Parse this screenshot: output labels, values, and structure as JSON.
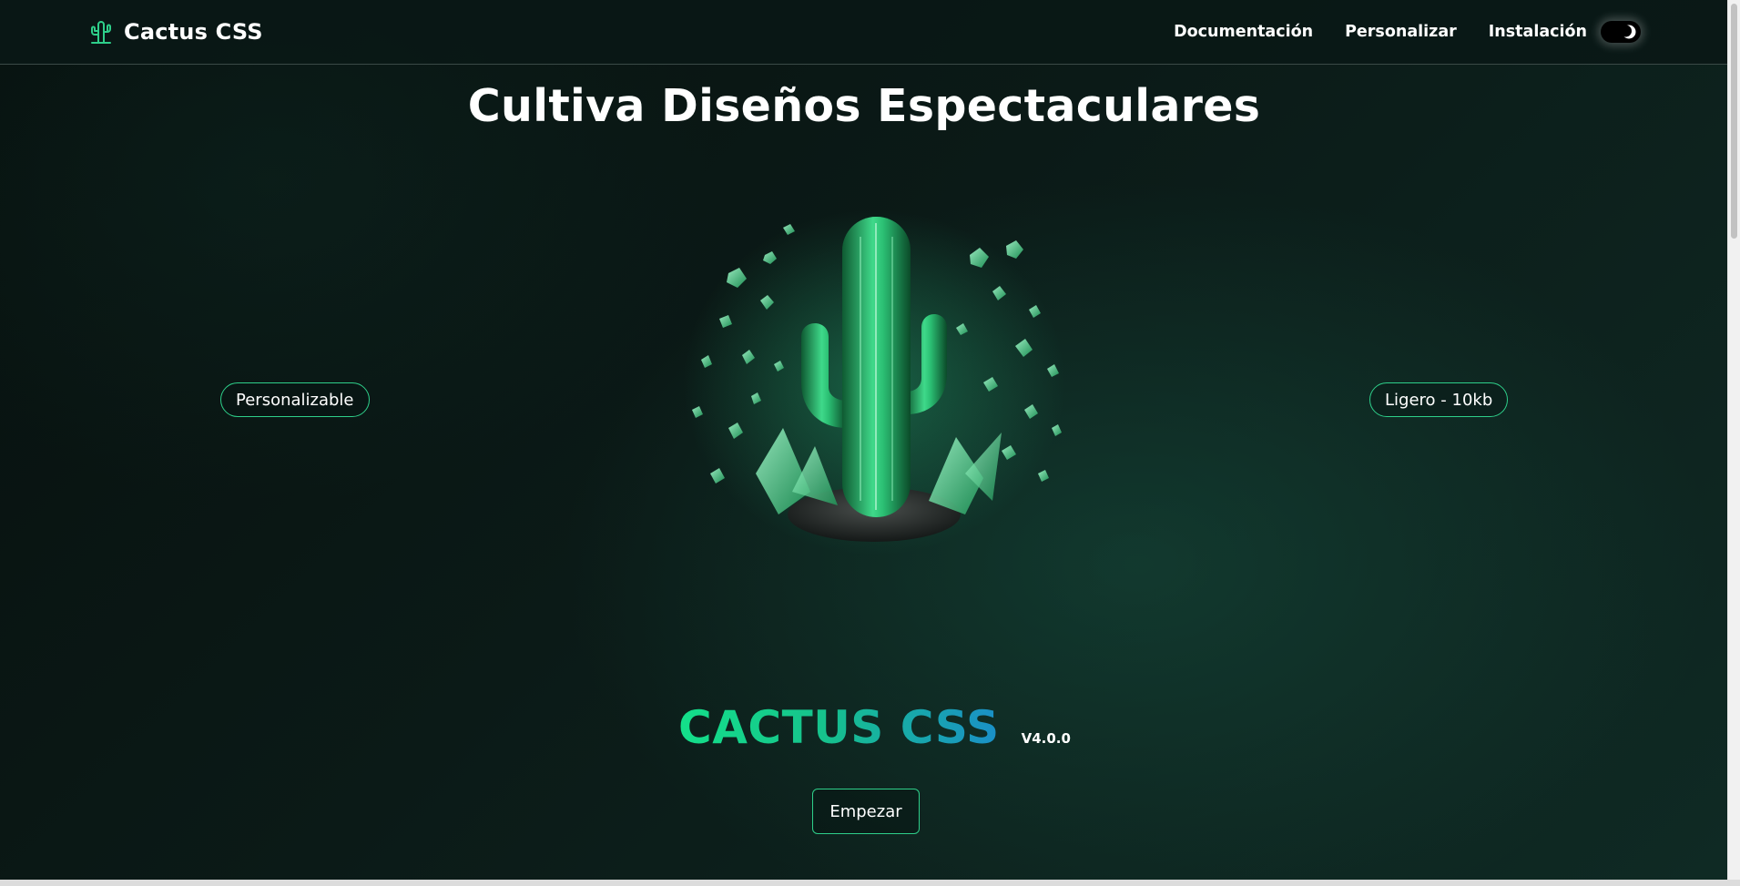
{
  "navbar": {
    "brand": "Cactus CSS",
    "links": [
      "Documentación",
      "Personalizar",
      "Instalación"
    ],
    "theme_toggle_icon": "moon-icon"
  },
  "hero": {
    "title": "Cultiva Diseños Espectaculares",
    "left_badge": "Personalizable",
    "right_badge": "Ligero - 10kb",
    "logo_text": "CACTUS CSS",
    "version": "V4.0.0",
    "cta_label": "Empezar",
    "illustration": "crystal-cactus-illustration"
  },
  "colors": {
    "accent": "#2ecf8a",
    "gradient_start": "#14e08a",
    "gradient_end": "#1a8fc8",
    "background": "#0b1a17"
  }
}
